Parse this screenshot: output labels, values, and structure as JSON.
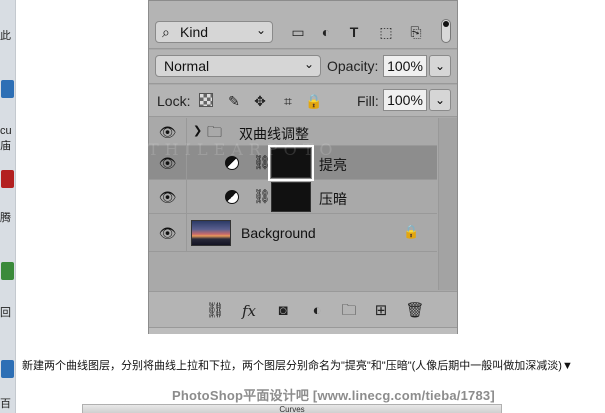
{
  "desktop_strip": {
    "fragments": [
      "此",
      "cu",
      "庙",
      "腾",
      "回",
      "百"
    ]
  },
  "layers_panel": {
    "filter": {
      "label": "Kind",
      "icons": [
        "image-filter-icon",
        "adjustment-filter-icon",
        "type-filter-icon",
        "shape-filter-icon",
        "smart-object-filter-icon"
      ]
    },
    "blend_mode": "Normal",
    "opacity_label": "Opacity:",
    "opacity_value": "100%",
    "lock_label": "Lock:",
    "fill_label": "Fill:",
    "fill_value": "100%",
    "layers": [
      {
        "type": "group",
        "name": "双曲线调整",
        "expanded": true,
        "visible": true
      },
      {
        "type": "curves-adjustment",
        "name": "提亮",
        "visible": true,
        "selected": true,
        "indented": true
      },
      {
        "type": "curves-adjustment",
        "name": "压暗",
        "visible": true,
        "selected": false,
        "indented": true
      },
      {
        "type": "pixel",
        "name": "Background",
        "visible": true,
        "locked": true
      }
    ],
    "footer_icons": [
      "link-icon",
      "fx-icon",
      "mask-icon",
      "adjustment-icon",
      "folder-icon",
      "new-layer-icon",
      "trash-icon"
    ],
    "fx_label": "fx"
  },
  "watermark": "THILEARPOTO",
  "caption": "新建两个曲线图层，分别将曲线上拉和下拉，两个图层分别命名为\"提亮\"和\"压暗\"(人像后期中一般叫做加深减淡)▼",
  "site_watermark": "PhotoShop平面设计吧 [www.linecg.com/tieba/1783]",
  "bottom_window_title": "Curves"
}
